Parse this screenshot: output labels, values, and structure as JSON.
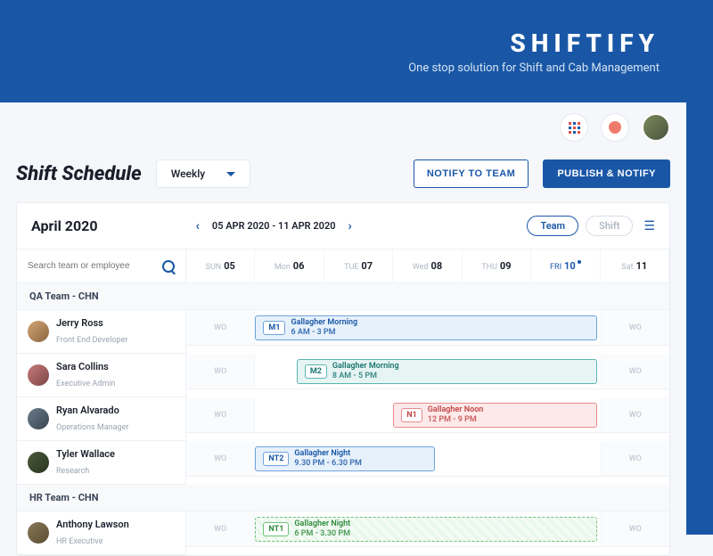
{
  "brand": {
    "title": "SHIFTIFY",
    "subtitle": "One stop solution for Shift and Cab Management"
  },
  "page": {
    "title": "Shift Schedule",
    "view": "Weekly"
  },
  "actions": {
    "notify": "NOTIFY TO TEAM",
    "publish": "PUBLISH & NOTIFY"
  },
  "calendar": {
    "month": "April 2020",
    "range": "05  APR  2020 - 11  APR  2020",
    "toggle": {
      "team": "Team",
      "shift": "Shift"
    },
    "days": [
      {
        "dow": "SUN",
        "num": "05"
      },
      {
        "dow": "Mon",
        "num": "06"
      },
      {
        "dow": "TUE",
        "num": "07"
      },
      {
        "dow": "Wed",
        "num": "08"
      },
      {
        "dow": "THU",
        "num": "09"
      },
      {
        "dow": "FRI",
        "num": "10"
      },
      {
        "dow": "Sat",
        "num": "11"
      }
    ]
  },
  "search": {
    "placeholder": "Search team or employee"
  },
  "wo": "WO",
  "groups": [
    {
      "name": "QA Team - CHN"
    },
    {
      "name": "HR Team - CHN"
    }
  ],
  "employees": [
    {
      "name": "Jerry Ross",
      "role": "Front End Developer",
      "shift": {
        "tag": "M1",
        "title": "Gallagher Morning",
        "time": "6 AM - 3 PM"
      }
    },
    {
      "name": "Sara Collins",
      "role": "Executive Admin",
      "shift": {
        "tag": "M2",
        "title": "Gallagher Morning",
        "time": "8 AM - 5 PM"
      }
    },
    {
      "name": "Ryan Alvarado",
      "role": "Operations Manager",
      "shift": {
        "tag": "N1",
        "title": "Gallagher Noon",
        "time": "12 PM - 9 PM"
      }
    },
    {
      "name": "Tyler Wallace",
      "role": "Research",
      "shift": {
        "tag": "NT2",
        "title": "Gallagher Night",
        "time": "9.30 PM - 6.30 PM"
      }
    },
    {
      "name": "Anthony Lawson",
      "role": "HR Executive",
      "shift": {
        "tag": "NT1",
        "title": "Gallagher Night",
        "time": "6 PM - 3.30 PM"
      }
    }
  ]
}
